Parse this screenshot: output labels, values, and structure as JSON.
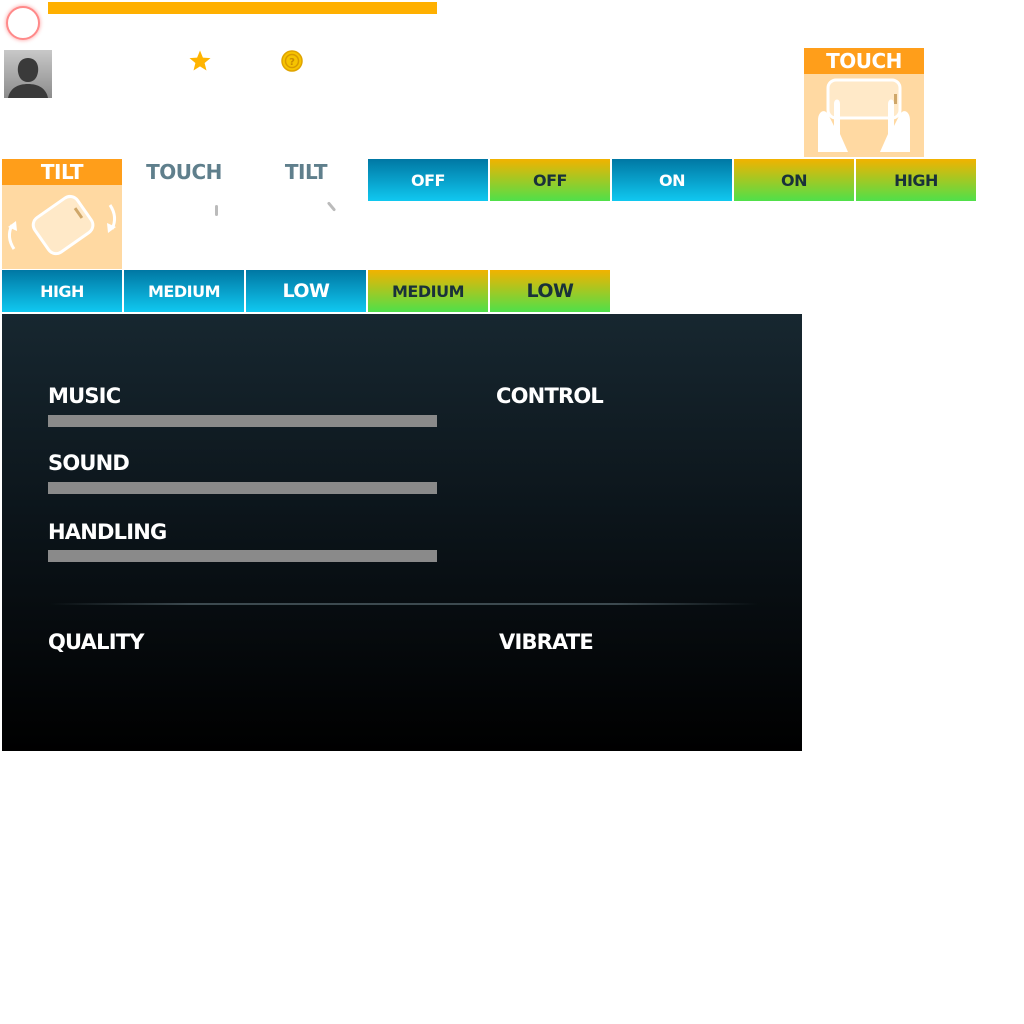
{
  "modes": {
    "touch_card_label": "TOUCH",
    "tilt_card_label": "TILT",
    "tab_touch": "TOUCH",
    "tab_tilt": "TILT"
  },
  "buttons_row1": [
    "OFF",
    "OFF",
    "ON",
    "ON",
    "HIGH"
  ],
  "buttons_row2": [
    "HIGH",
    "MEDIUM",
    "LOW",
    "MEDIUM",
    "LOW"
  ],
  "settings": {
    "music": "MUSIC",
    "sound": "SOUND",
    "handling": "HANDLING",
    "control": "CONTROL",
    "quality": "QUALITY",
    "vibrate": "VIBRATE"
  },
  "colors": {
    "accent_orange": "#ffb000",
    "card_head": "#ff9e1a",
    "card_body": "#ffd9a2",
    "blue_button": "#10c8f0",
    "green_button": "#4fe04a"
  },
  "icons": {
    "star": "star-icon",
    "coin": "coin-icon",
    "avatar": "avatar-silhouette-icon",
    "touch": "hands-holding-phone-icon",
    "tilt": "tilt-phone-icon"
  }
}
